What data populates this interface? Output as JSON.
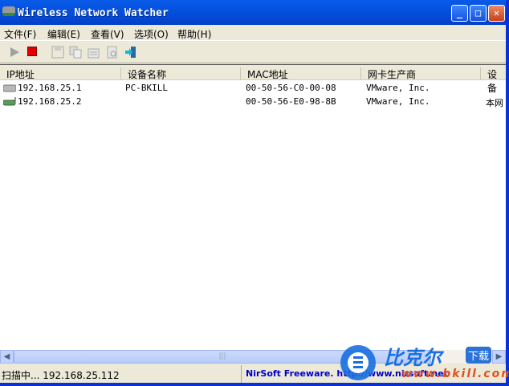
{
  "window": {
    "title": "Wireless Network Watcher",
    "minimize": "_",
    "maximize": "□",
    "close": "✕"
  },
  "menu": [
    "文件(F)",
    "编辑(E)",
    "查看(V)",
    "选项(O)",
    "帮助(H)"
  ],
  "toolbar": [
    "play-icon",
    "stop-icon",
    "save-icon",
    "copy-icon",
    "properties-icon",
    "report-icon",
    "exit-icon"
  ],
  "columns": [
    "IP地址",
    "设备名称",
    "MAC地址",
    "网卡生产商",
    "设备"
  ],
  "rows": [
    {
      "ip": "192.168.25.1",
      "name": "PC-BKILL",
      "mac": "00-50-56-C0-00-08",
      "vendor": "VMware, Inc.",
      "info": ""
    },
    {
      "ip": "192.168.25.2",
      "name": "",
      "mac": "00-50-56-E0-98-8B",
      "vendor": "VMware, Inc.",
      "info": "本网"
    }
  ],
  "status": {
    "scan": "扫描中... 192.168.25.112",
    "link": "NirSoft Freeware. http://www.nirsoft.net"
  },
  "watermark": {
    "brand": "比克尔",
    "tag": "下载",
    "url": "www.bkill.com"
  },
  "colors": {
    "title": "#0452e0",
    "stop": "#e00000",
    "link": "#0000cc"
  }
}
